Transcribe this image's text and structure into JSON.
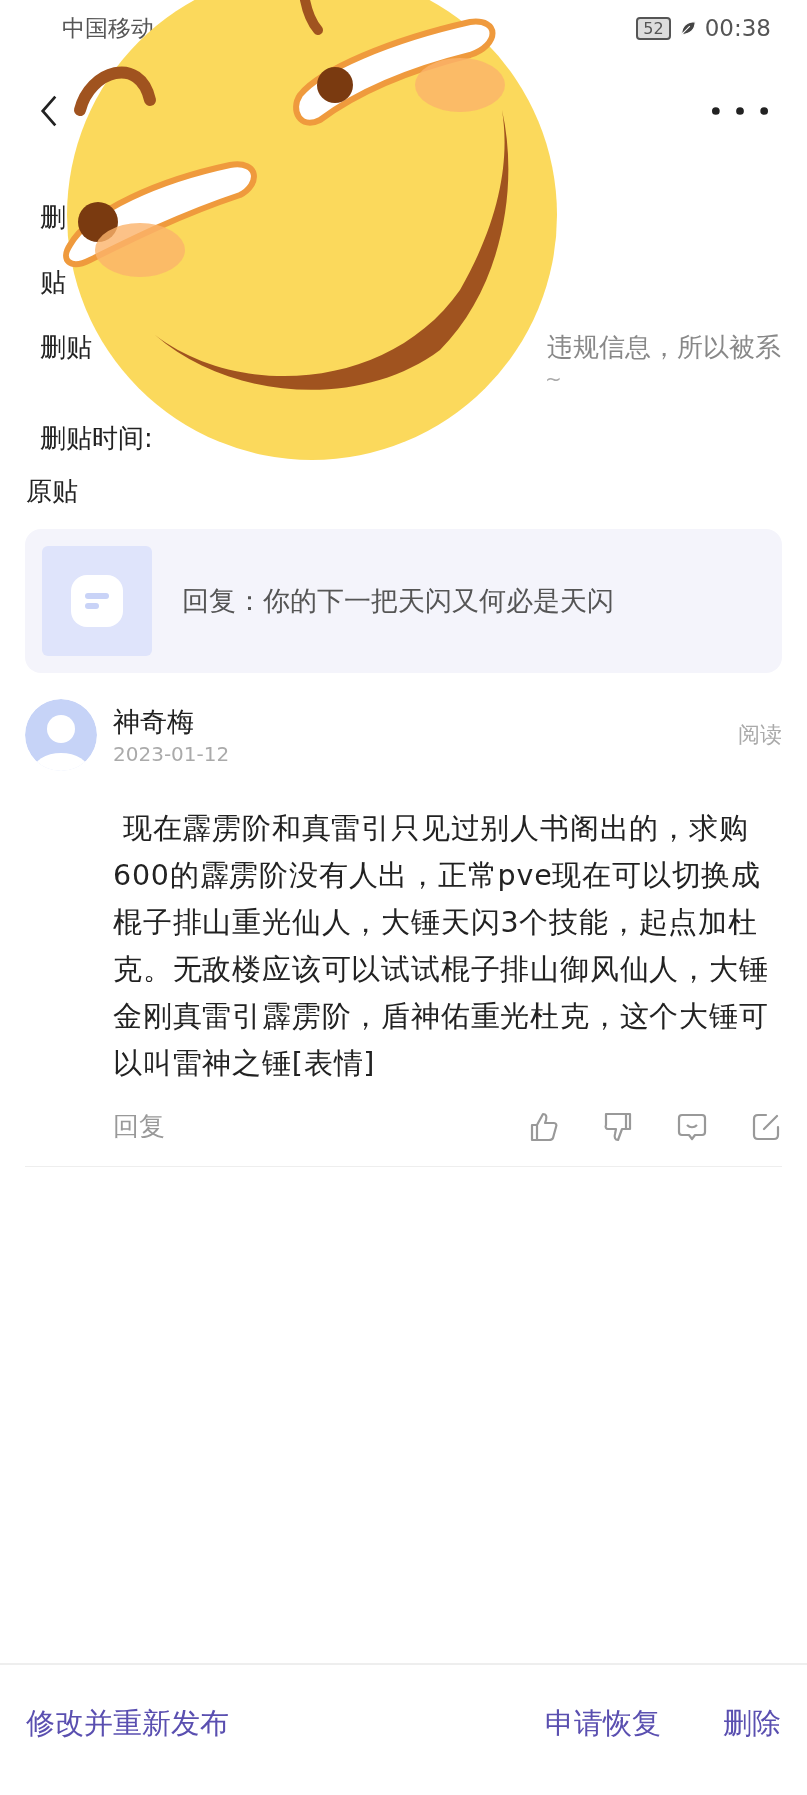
{
  "status_bar": {
    "carrier": "中国移动",
    "battery": "52",
    "time": "00:38"
  },
  "info_rows": [
    {
      "label": "删",
      "value": ""
    },
    {
      "label": "贴",
      "value": ""
    },
    {
      "label": "删贴",
      "value": "违规信息，所以被系",
      "note": "~"
    },
    {
      "label": "删贴时间:",
      "value": ""
    }
  ],
  "section_title": "原贴",
  "quoted_post": {
    "text": "回复：你的下一把天闪又何必是天闪"
  },
  "comment": {
    "author": "神奇梅",
    "date": "2023-01-12",
    "read_label": "阅读",
    "body": " 现在霹雳阶和真雷引只见过别人书阁出的，求购600的霹雳阶没有人出，正常pve现在可以切换成棍子排山重光仙人，大锤天闪3个技能，起点加杜克。无敌楼应该可以试试棍子排山御风仙人，大锤金刚真雷引霹雳阶，盾神佑重光杜克，这个大锤可以叫雷神之锤[表情]",
    "reply_label": "回复"
  },
  "bottom_actions": {
    "left": "修改并重新发布",
    "right": [
      "申请恢复",
      "删除"
    ]
  }
}
